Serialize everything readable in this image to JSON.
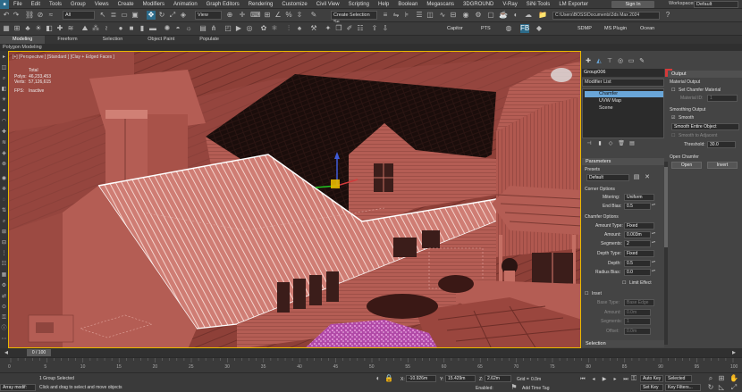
{
  "menu": {
    "items": [
      "File",
      "Edit",
      "Tools",
      "Group",
      "Views",
      "Create",
      "Modifiers",
      "Animation",
      "Graph Editors",
      "Rendering",
      "Customize",
      "Civil View",
      "Scripting",
      "Help",
      "Boolean",
      "Megascans",
      "3DGROUND",
      "V-Ray",
      "SiNi Tools",
      "LM Exporter"
    ],
    "signin": "Sign In",
    "workspace_label": "Workspaces:",
    "workspace_value": "Default"
  },
  "toolbar": {
    "selection_filter": "All",
    "ref_coord": "View",
    "create_selection_set": "Create Selection Se",
    "project_path": "C:\\Users\\BOSS\\Documents\\3ds Max 2024"
  },
  "toolbar2": {
    "labels": [
      "Capitor",
      "PTS",
      "SDMP",
      "MS Plugin",
      "Ocean"
    ]
  },
  "ribbon": {
    "tabs": [
      "Modeling",
      "Freeform",
      "Selection",
      "Object Paint",
      "Populate"
    ],
    "active_tab": "Modeling",
    "sub_label": "Polygon Modeling"
  },
  "viewport": {
    "label": "[+] [Perspective ] [Standard ] [Clay + Edged Faces ]",
    "stats": {
      "total_label": "Total",
      "polys_label": "Polys:",
      "polys_value": "46,233,453",
      "verts_label": "Verts:",
      "verts_value": "57,126,615",
      "fps_label": "FPS:",
      "fps_value": "Inactive"
    }
  },
  "command_panel": {
    "object_name": "Group006",
    "modifier_list": "Modifier List",
    "stack": [
      "Chamfer",
      "UVW Map",
      "Scene"
    ],
    "selected_stack_item": "Chamfer",
    "parameters_title": "Parameters",
    "presets_label": "Presets",
    "presets_value": "Default",
    "corner_options_label": "Corner Options",
    "mitering_label": "Mitering:",
    "mitering_value": "Uniform",
    "end_bias_label": "End Bias:",
    "end_bias_value": "0.5",
    "chamfer_options_label": "Chamfer Options",
    "amount_type_label": "Amount Type:",
    "amount_type_value": "Fixed",
    "amount_label": "Amount:",
    "amount_value": "0.003m",
    "segments_label": "Segments:",
    "segments_value": "2",
    "depth_type_label": "Depth Type:",
    "depth_type_value": "Fixed",
    "depth_label": "Depth:",
    "depth_value": "0.5",
    "radius_bias_label": "Radius Bias:",
    "radius_bias_value": "0.0",
    "limit_effect_label": "Limit Effect",
    "inset_label": "Inset",
    "inset_rows": [
      {
        "label": "Base Type:",
        "value": "Base Edge"
      },
      {
        "label": "Amount:",
        "value": "0.0m"
      },
      {
        "label": "Segments:",
        "value": "1"
      },
      {
        "label": "Offset:",
        "value": "0.0m"
      }
    ],
    "selection_label": "Selection",
    "output_title": "Output",
    "material_output_label": "Material Output",
    "set_chamfer_material_label": "Set Chamfer Material",
    "material_id_label": "Material ID:",
    "material_id_value": "1",
    "smoothing_output_label": "Smoothing Output",
    "smooth_label": "Smooth",
    "smooth_mode_value": "Smooth Entire Object",
    "smooth_to_adjacent_label": "Smooth to Adjacent",
    "threshold_label": "Threshold:",
    "threshold_value": "30.0",
    "open_chamfer_label": "Open Chamfer",
    "open_button": "Open",
    "invert_button": "Invert"
  },
  "timeline": {
    "slider": "0 / 100",
    "ticks": [
      "0",
      "5",
      "10",
      "15",
      "20",
      "25",
      "30",
      "35",
      "40",
      "45",
      "50",
      "55",
      "60",
      "65",
      "70",
      "75",
      "80",
      "85",
      "90",
      "95",
      "100"
    ]
  },
  "status": {
    "maxscript": "Array modif:",
    "selected": "1 Group Selected",
    "prompt": "Click and drag to select and move objects",
    "x_label": "X:",
    "x_value": "-10.926m",
    "y_label": "Y:",
    "y_value": "15.429m",
    "z_label": "Z:",
    "z_value": "2.62m",
    "grid_label": "Grid =",
    "grid_value": "0.0m",
    "enabled_label": "Enabled:",
    "add_time_tag": "Add Time Tag",
    "auto_key": "Auto Key",
    "set_key": "Set Key",
    "selected_filter": "Selected",
    "key_filters": "Key Filters..."
  },
  "colors": {
    "viewport_bg": "#3c1c19",
    "viewport_border": "#e8b800",
    "clay": "#c46e63",
    "selection": "#6aa6d8"
  }
}
